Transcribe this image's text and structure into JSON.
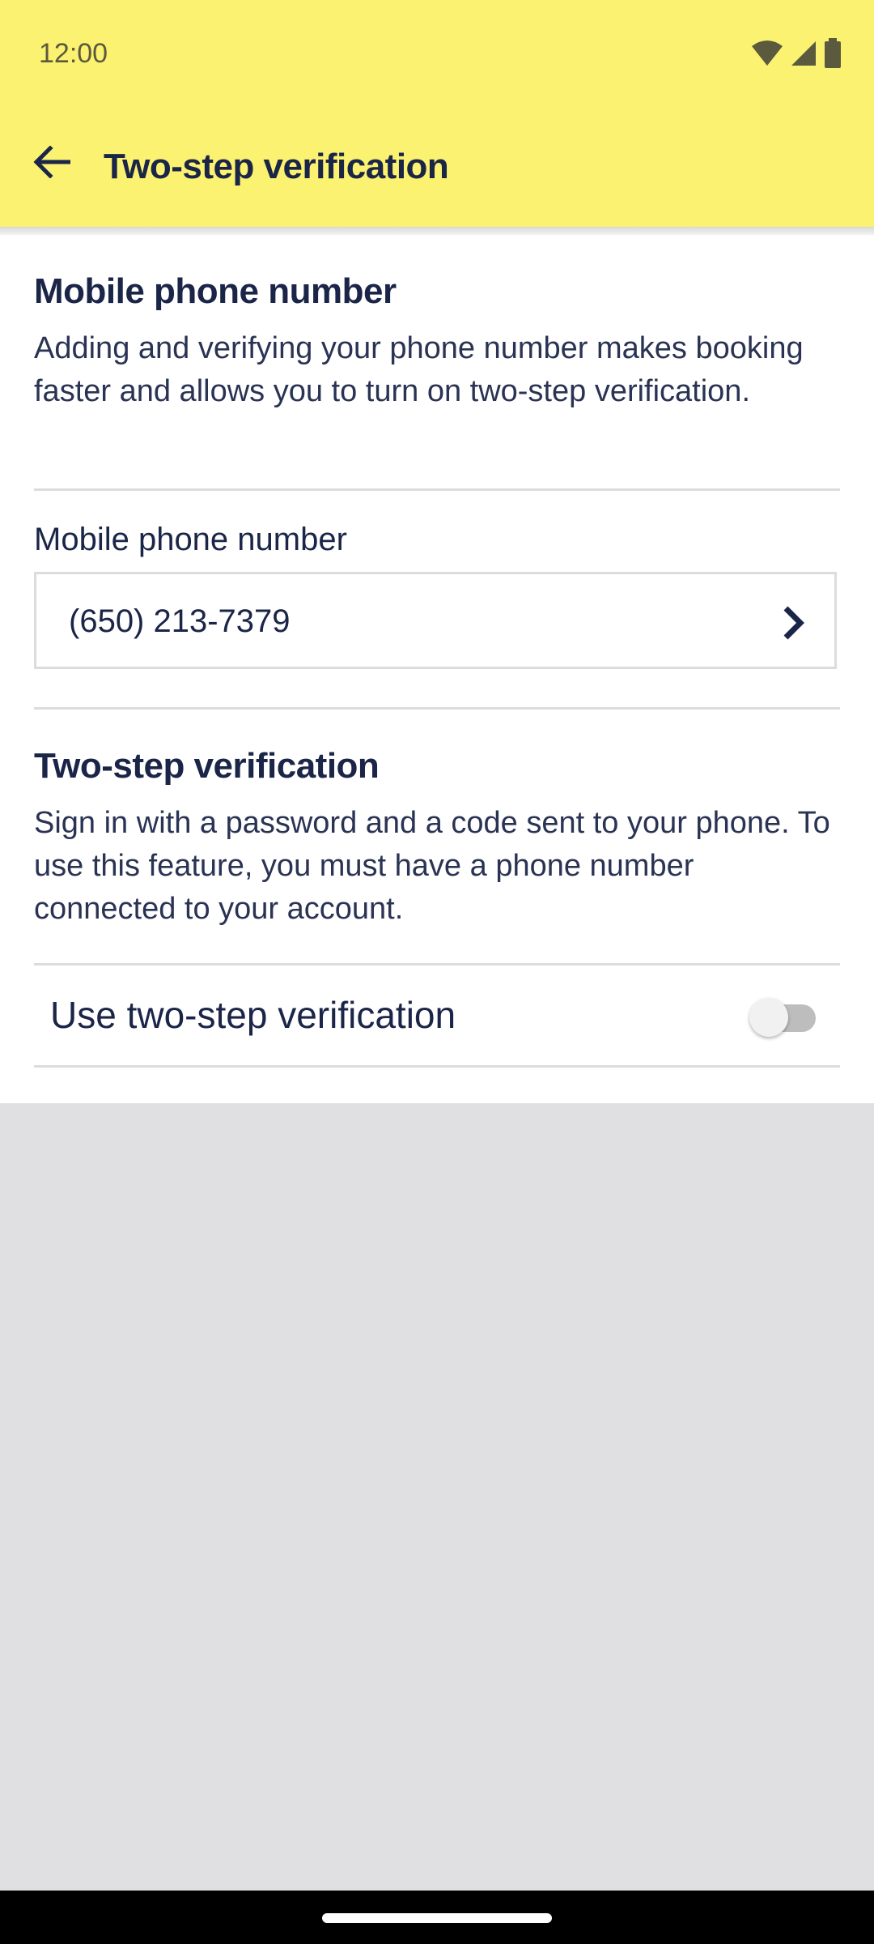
{
  "status_bar": {
    "time": "12:00",
    "icons": [
      "wifi-icon",
      "cellular-signal-icon",
      "battery-icon"
    ]
  },
  "header": {
    "back_icon": "arrow-back-icon",
    "title": "Two-step verification"
  },
  "phone_section": {
    "heading": "Mobile phone number",
    "description": "Adding and verifying your phone number makes booking faster and allows you to turn on two-step verification.",
    "field_label": "Mobile phone number",
    "field_value": "(650) 213-7379",
    "field_icon": "chevron-right-icon"
  },
  "two_step_section": {
    "heading": "Two-step verification",
    "description": "Sign in with a password and a code sent to your phone. To use this feature, you must have a phone number connected to your account.",
    "toggle_label": "Use two-step verification",
    "toggle_on": false
  },
  "colors": {
    "app_bar": "#faf270",
    "text_primary": "#1b2548",
    "background": "#e0e0e3"
  }
}
